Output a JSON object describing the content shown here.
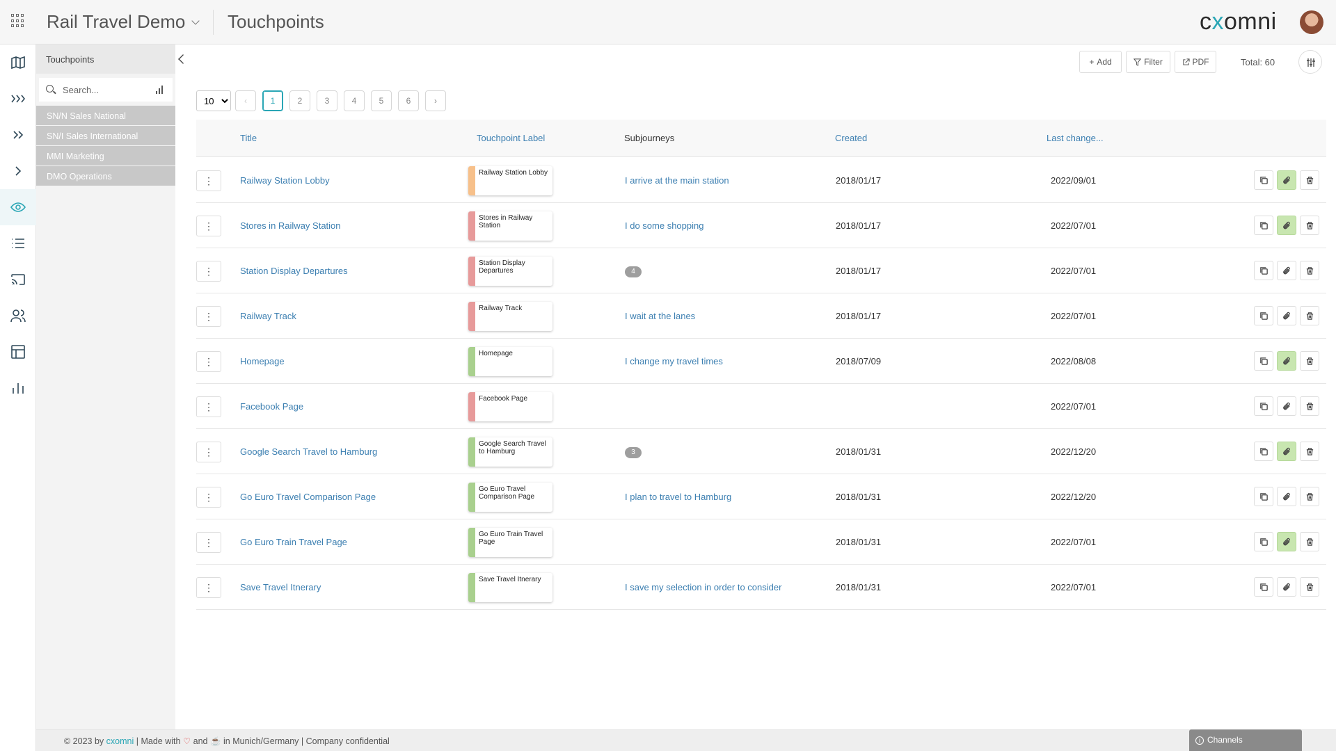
{
  "header": {
    "app_title": "Rail Travel Demo",
    "page_title": "Touchpoints",
    "logo": {
      "part1": "c",
      "part2": "x",
      "part3": "omni"
    }
  },
  "rail": {
    "icons": [
      "map-icon",
      "triple-chevron-icon",
      "double-chevron-icon",
      "chevron-right-icon",
      "eye-icon",
      "list-icon",
      "cast-icon",
      "users-icon",
      "table-icon",
      "bar-chart-icon"
    ],
    "active": "eye-icon"
  },
  "tree": {
    "heading": "Touchpoints",
    "search_placeholder": "Search...",
    "items": [
      {
        "label": "SN/N Sales National"
      },
      {
        "label": "SN/I Sales International"
      },
      {
        "label": "MMI Marketing"
      },
      {
        "label": "DMO Operations"
      }
    ]
  },
  "toolbar": {
    "add_label": "Add",
    "filter_label": "Filter",
    "pdf_label": "PDF",
    "total_label": "Total: 60"
  },
  "pagination": {
    "page_size": "10",
    "pages": [
      "1",
      "2",
      "3",
      "4",
      "5",
      "6"
    ],
    "current_page": "1",
    "prev": "‹",
    "next": "›"
  },
  "table": {
    "columns": {
      "title": "Title",
      "label": "Touchpoint Label",
      "subjourneys": "Subjourneys",
      "created": "Created",
      "last_changed": "Last change..."
    },
    "label_colors": {
      "orange": "#f7c08a",
      "red": "#e79a9a",
      "green": "#a9d08e"
    },
    "rows": [
      {
        "title": "Railway Station Lobby",
        "label": "Railway Station Lobby",
        "label_color": "#f7c08a",
        "sub": "I arrive at the main station",
        "badge": "",
        "created": "2018/01/17",
        "changed": "2022/09/01",
        "attachment_active": true
      },
      {
        "title": "Stores in Railway Station",
        "label": "Stores in Railway Station",
        "label_color": "#e79a9a",
        "sub": "I do some shopping",
        "badge": "",
        "created": "2018/01/17",
        "changed": "2022/07/01",
        "attachment_active": true
      },
      {
        "title": "Station Display Departures",
        "label": "Station Display Departures",
        "label_color": "#e79a9a",
        "sub": "",
        "badge": "4",
        "created": "2018/01/17",
        "changed": "2022/07/01",
        "attachment_active": false
      },
      {
        "title": "Railway Track",
        "label": "Railway Track",
        "label_color": "#e79a9a",
        "sub": "I wait at the lanes",
        "badge": "",
        "created": "2018/01/17",
        "changed": "2022/07/01",
        "attachment_active": false
      },
      {
        "title": "Homepage",
        "label": "Homepage",
        "label_color": "#a9d08e",
        "sub": "I change my travel times",
        "badge": "",
        "created": "2018/07/09",
        "changed": "2022/08/08",
        "attachment_active": true
      },
      {
        "title": "Facebook Page",
        "label": "Facebook Page",
        "label_color": "#e79a9a",
        "sub": "",
        "badge": "",
        "created": "",
        "changed": "2022/07/01",
        "attachment_active": false
      },
      {
        "title": "Google Search Travel to Hamburg",
        "label": "Google Search Travel to Hamburg",
        "label_color": "#a9d08e",
        "sub": "",
        "badge": "3",
        "created": "2018/01/31",
        "changed": "2022/12/20",
        "attachment_active": true
      },
      {
        "title": "Go Euro Travel Comparison Page",
        "label": "Go Euro Travel Comparison Page",
        "label_color": "#a9d08e",
        "sub": "I plan to travel to Hamburg",
        "badge": "",
        "created": "2018/01/31",
        "changed": "2022/12/20",
        "attachment_active": false
      },
      {
        "title": "Go Euro Train Travel Page",
        "label": "Go Euro Train Travel Page",
        "label_color": "#a9d08e",
        "sub": "",
        "badge": "",
        "created": "2018/01/31",
        "changed": "2022/07/01",
        "attachment_active": true
      },
      {
        "title": "Save Travel Itnerary",
        "label": "Save Travel Itnerary",
        "label_color": "#a9d08e",
        "sub": "I save my selection in order to consider",
        "badge": "",
        "created": "2018/01/31",
        "changed": "2022/07/01",
        "attachment_active": false
      }
    ]
  },
  "footer": {
    "prefix": "© 2023 by",
    "brand": "cxomni",
    "made_with": "| Made with",
    "and": "and",
    "suffix": "in Munich/Germany | Company confidential"
  },
  "channels_tab": {
    "label": "Channels"
  }
}
